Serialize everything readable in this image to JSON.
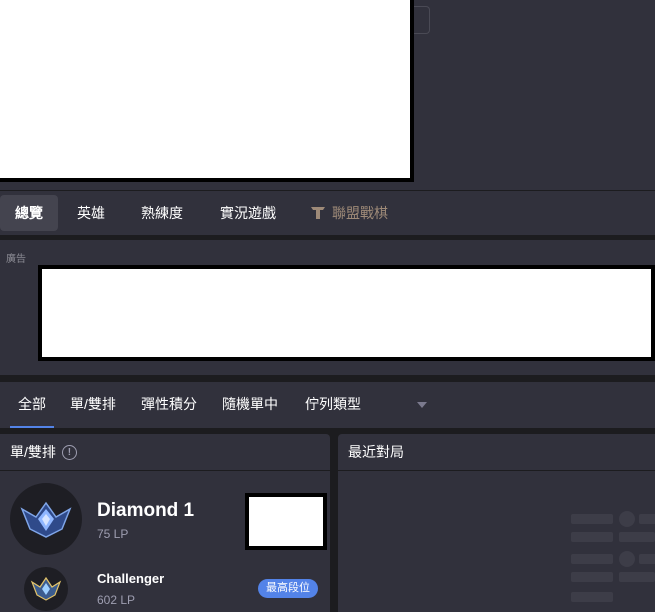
{
  "tabs": {
    "overview": "總覽",
    "champions": "英雄",
    "mastery": "熟練度",
    "live_game": "實況遊戲",
    "tft": "聯盟戰棋"
  },
  "ad": {
    "label": "廣告"
  },
  "queue_filters": {
    "all": "全部",
    "solo_duo": "單/雙排",
    "flex": "彈性積分",
    "aram": "隨機單中",
    "queue_type": "佇列類型"
  },
  "ranked": {
    "title": "單/雙排",
    "current_tier": "Diamond 1",
    "current_lp": "75 LP",
    "peak_tier": "Challenger",
    "peak_lp": "602 LP",
    "peak_badge": "最高段位"
  },
  "recent": {
    "title": "最近對局"
  },
  "colors": {
    "accent": "#5383e8",
    "panel": "#31313c",
    "background": "#1c1c1f",
    "tft": "#9e8a78"
  }
}
